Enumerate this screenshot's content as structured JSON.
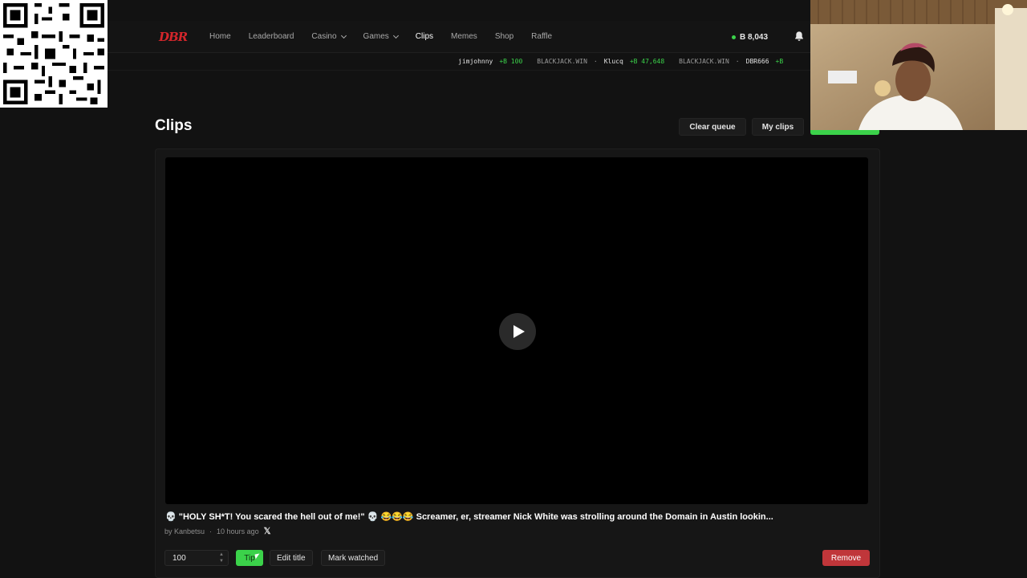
{
  "navbar": {
    "logo": "DBR",
    "links": [
      {
        "label": "Home"
      },
      {
        "label": "Leaderboard"
      },
      {
        "label": "Casino"
      },
      {
        "label": "Games"
      },
      {
        "label": "Clips"
      },
      {
        "label": "Memes"
      },
      {
        "label": "Shop"
      },
      {
        "label": "Raffle"
      }
    ],
    "active": "Clips",
    "balance": "B 8,043",
    "bell_icon": "bell-icon"
  },
  "ticker": {
    "items": [
      {
        "user": "jimjohnny",
        "amount": "+B 100",
        "game": "BLACKJACK.WIN"
      },
      {
        "user": "Klucq",
        "amount": "+B 47,648",
        "game": "BLACKJACK.WIN"
      },
      {
        "user": "DBR666",
        "amount": "+B",
        "game": ""
      }
    ]
  },
  "header": {
    "title": "Clips",
    "clear_queue": "Clear queue",
    "my_clips": "My clips"
  },
  "clip": {
    "title": "💀 \"HOLY SH*T! You scared the hell out of me!\" 💀 😂😂😂 Screamer, er, streamer Nick White was strolling around the Domain in Austin lookin...",
    "author": "by Kanbetsu",
    "time": "10 hours ago",
    "source_icon": "x-icon"
  },
  "actions": {
    "amount_value": "100",
    "tip": "Tip",
    "edit_title": "Edit title",
    "mark_watched": "Mark watched",
    "remove": "Remove"
  },
  "colors": {
    "accent_green": "#3bd24a",
    "danger_red": "#c0363a",
    "logo_red": "#d3262b"
  }
}
